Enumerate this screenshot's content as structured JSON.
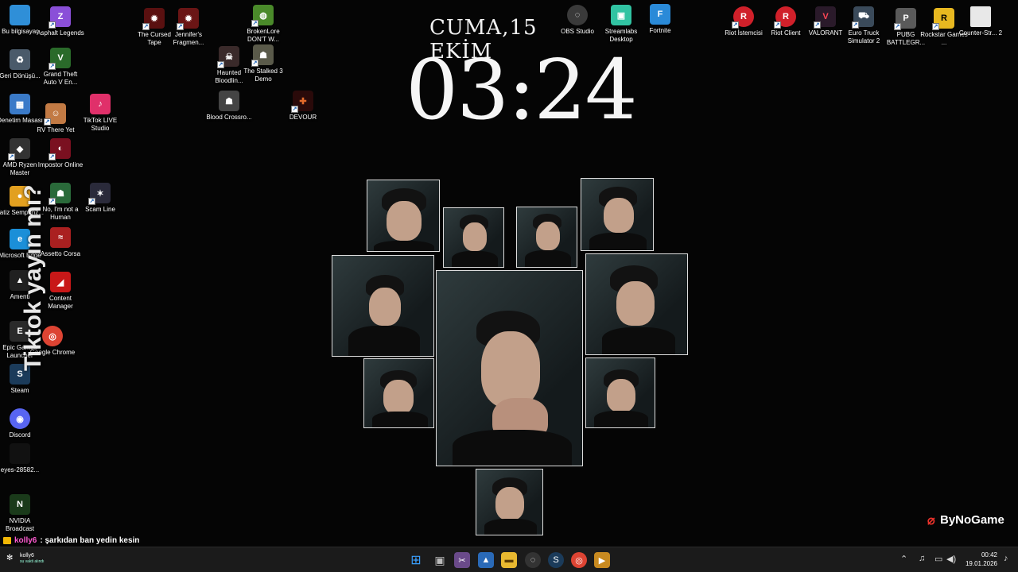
{
  "clock": {
    "date": "CUMA,15 EKİM",
    "time": "03:24"
  },
  "desktop_icons": [
    {
      "label": "Bu bilgisayar",
      "color": "#2f8fd8",
      "glyph": "▭"
    },
    {
      "label": "Geri Dönüşü...",
      "color": "#4a5a6a",
      "glyph": "♻"
    },
    {
      "label": "Denetim Masası",
      "color": "#3a7ac8",
      "glyph": "▦"
    },
    {
      "label": "AMD Ryzen Master",
      "color": "#333333",
      "glyph": "◆"
    },
    {
      "label": "Vatiz Sempanz...",
      "color": "#e2a020",
      "glyph": "●"
    },
    {
      "label": "Microsoft Edge",
      "color": "#1b8fd8",
      "glyph": "e"
    },
    {
      "label": "Amenti",
      "color": "#202020",
      "glyph": "▲"
    },
    {
      "label": "Epic Games Launcher",
      "color": "#2a2a2a",
      "glyph": "E"
    },
    {
      "label": "Steam",
      "color": "#1b3b5a",
      "glyph": "S"
    },
    {
      "label": "Discord",
      "color": "#5865f2",
      "glyph": "◉"
    },
    {
      "label": "eyes-28582...",
      "color": "#111111",
      "glyph": "·"
    },
    {
      "label": "NVIDIA Broadcast",
      "color": "#1a3a1a",
      "glyph": "N"
    },
    {
      "label": "Asphalt Legends",
      "color": "#8a4fd8",
      "glyph": "Z"
    },
    {
      "label": "Grand Theft Auto V En...",
      "color": "#2a6a2a",
      "glyph": "V"
    },
    {
      "label": "RV There Yet",
      "color": "#c27a44",
      "glyph": "☺"
    },
    {
      "label": "Impostor Online",
      "color": "#7a1020",
      "glyph": "◐"
    },
    {
      "label": "No, I'm not a Human",
      "color": "#2a6a3a",
      "glyph": "☗"
    },
    {
      "label": "Assetto Corsa",
      "color": "#aa2020",
      "glyph": "≈"
    },
    {
      "label": "Content Manager",
      "color": "#c81818",
      "glyph": "◢"
    },
    {
      "label": "Google Chrome",
      "color": "#dd4433",
      "glyph": "◎"
    },
    {
      "label": "TikTok LIVE Studio",
      "color": "#e0306a",
      "glyph": "♪"
    },
    {
      "label": "Scam Line",
      "color": "#2a2a3a",
      "glyph": "✶"
    },
    {
      "label": "The Cursed Tape",
      "color": "#5a1010",
      "glyph": "✹"
    },
    {
      "label": "Jennifer's Fragmen...",
      "color": "#6a1515",
      "glyph": "✹"
    },
    {
      "label": "Haunted Bloodlin...",
      "color": "#3a2a2a",
      "glyph": "☠"
    },
    {
      "label": "Blood Crossro...",
      "color": "#444444",
      "glyph": "☗"
    },
    {
      "label": "BrokenLore DON'T W...",
      "color": "#4a8a2a",
      "glyph": "◍"
    },
    {
      "label": "The Stalked 3 Demo",
      "color": "#5a5a4a",
      "glyph": "☗"
    },
    {
      "label": "DEVOUR",
      "color": "#2a0a0a",
      "glyph": "✚"
    },
    {
      "label": "OBS Studio",
      "color": "#3a3a3a",
      "glyph": "◌"
    },
    {
      "label": "Streamlabs Desktop",
      "color": "#31c3a2",
      "glyph": "▣"
    },
    {
      "label": "Fortnite",
      "color": "#2a8ad8",
      "glyph": "F"
    },
    {
      "label": "Riot İstemcisi",
      "color": "#d0202a",
      "glyph": "R"
    },
    {
      "label": "Riot Client",
      "color": "#d0202a",
      "glyph": "R"
    },
    {
      "label": "VALORANT",
      "color": "#2a1a2a",
      "glyph": "V"
    },
    {
      "label": "Euro Truck Simulator 2",
      "color": "#3a4a5a",
      "glyph": "⛟"
    },
    {
      "label": "PUBG BATTLEGR...",
      "color": "#5a5a5a",
      "glyph": "P"
    },
    {
      "label": "Rockstar Games ...",
      "color": "#e8b820",
      "glyph": "R"
    },
    {
      "label": "Counter-Str... 2",
      "color": "#e8e8e8",
      "glyph": "▯"
    }
  ],
  "overlay": {
    "tiktok_watermark": "Tiktok yayın mı?",
    "brand": "ByNoGame",
    "chat_user": "kolly6",
    "chat_message": ": şarkıdan ban yedin kesin"
  },
  "taskbar": {
    "profile_name": "kolly6",
    "profile_sub": "su vakti alındı",
    "apps": [
      {
        "name": "start",
        "glyph": "⊞",
        "color": "#1e90ff"
      },
      {
        "name": "task-view",
        "glyph": "▣",
        "color": "#555555"
      },
      {
        "name": "snipping",
        "glyph": "✂",
        "color": "#6a4a8a"
      },
      {
        "name": "photos",
        "glyph": "▲",
        "color": "#2a6ab8"
      },
      {
        "name": "file-explorer",
        "glyph": "▬",
        "color": "#e8b830"
      },
      {
        "name": "obs",
        "glyph": "◌",
        "color": "#333333"
      },
      {
        "name": "steam",
        "glyph": "S",
        "color": "#1b3b5a"
      },
      {
        "name": "chrome",
        "glyph": "◎",
        "color": "#dd4433"
      },
      {
        "name": "app",
        "glyph": "▶",
        "color": "#c88a20"
      }
    ],
    "time": "00:42",
    "date": "19.01.2026"
  }
}
